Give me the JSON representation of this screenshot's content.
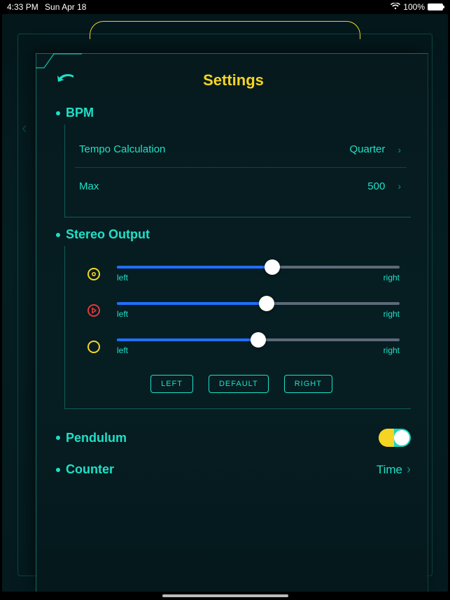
{
  "status_bar": {
    "time": "4:33 PM",
    "date": "Sun Apr 18",
    "battery_pct": "100%"
  },
  "panel": {
    "title": "Settings"
  },
  "bpm": {
    "heading": "BPM",
    "tempo_calc": {
      "label": "Tempo Calculation",
      "value": "Quarter"
    },
    "max": {
      "label": "Max",
      "value": "500"
    }
  },
  "stereo": {
    "heading": "Stereo Output",
    "labels": {
      "left": "left",
      "right": "right"
    },
    "sliders": [
      {
        "icon": "accent-circle",
        "pos": 55
      },
      {
        "icon": "play-circle",
        "pos": 53
      },
      {
        "icon": "open-circle",
        "pos": 50
      }
    ],
    "presets": {
      "left": "LEFT",
      "default": "DEFAULT",
      "right": "RIGHT"
    }
  },
  "pendulum": {
    "heading": "Pendulum",
    "enabled": true
  },
  "counter": {
    "heading": "Counter",
    "value": "Time"
  }
}
